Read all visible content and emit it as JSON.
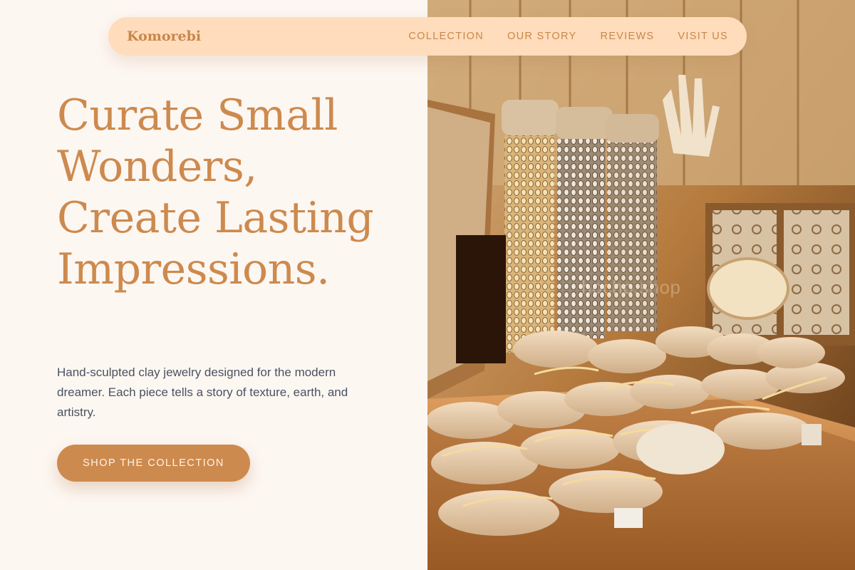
{
  "brand": {
    "name": "Komorebi"
  },
  "nav": {
    "links": [
      "COLLECTION",
      "OUR STORY",
      "REVIEWS",
      "VISIT US"
    ]
  },
  "hero": {
    "title": "Curate Small Wonders, Create Lasting Impressions.",
    "description": "Hand-sculpted clay jewelry designed for the modern dreamer. Each piece tells a story of texture, earth, and artistry.",
    "cta_label": "SHOP THE COLLECTION"
  },
  "image": {
    "watermark": "hocho.shop",
    "subject": "jewelry display with bracelets on cushions in wooden trays"
  },
  "colors": {
    "background": "#fdf7f2",
    "accent": "#cd8a4e",
    "nav_pill": "#ffdcbc",
    "body_text": "#4a5260"
  }
}
